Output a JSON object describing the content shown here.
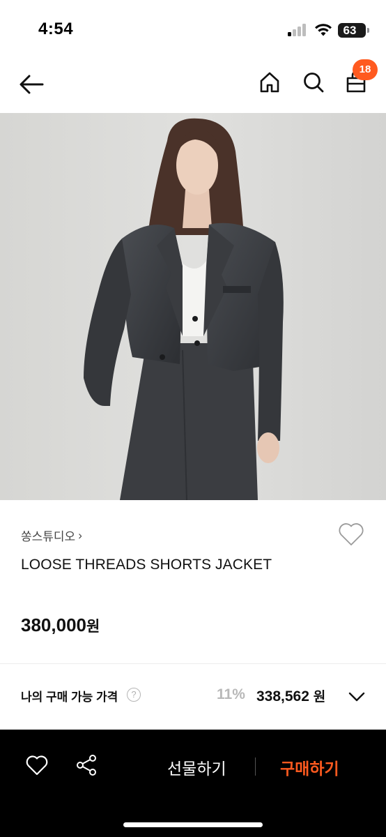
{
  "status_bar": {
    "time": "4:54",
    "battery": "63"
  },
  "nav": {
    "cart_count": "18"
  },
  "product": {
    "brand": "쏭스튜디오",
    "brand_chevron": "›",
    "name": "LOOSE THREADS SHORTS JACKET",
    "price": "380,000",
    "price_unit": "원"
  },
  "my_price": {
    "label": "나의 구매 가능 가격",
    "help": "?",
    "discount": "11%",
    "amount": "338,562",
    "unit": "원"
  },
  "bottom_bar": {
    "gift_label": "선물하기",
    "buy_label": "구매하기"
  },
  "colors": {
    "accent": "#ff5a1f",
    "bar_bg": "#000000",
    "muted": "#b8b8b8"
  },
  "icons": [
    "back-arrow-icon",
    "home-icon",
    "search-icon",
    "cart-icon",
    "heart-icon",
    "share-icon",
    "chevron-down-icon",
    "question-icon"
  ]
}
